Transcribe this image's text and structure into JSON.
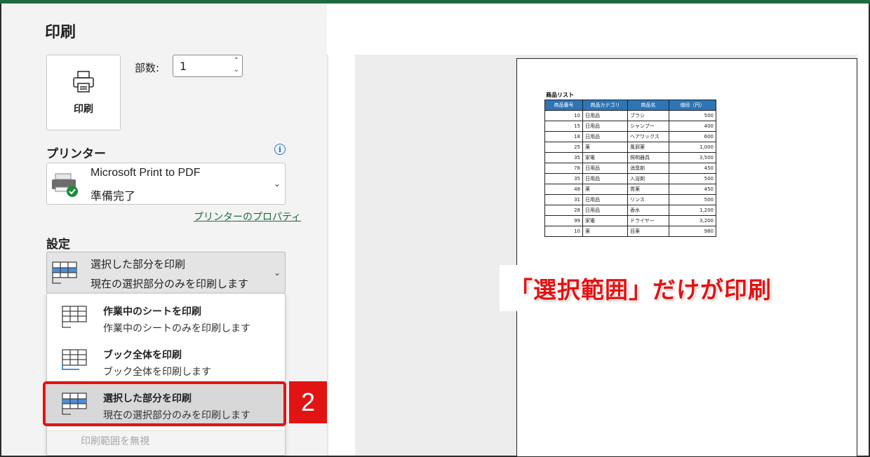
{
  "page": {
    "title": "印刷"
  },
  "print_button": {
    "label": "印刷"
  },
  "copies": {
    "label": "部数:",
    "value": "1"
  },
  "printer": {
    "section_title": "プリンター",
    "name": "Microsoft Print to PDF",
    "status": "準備完了",
    "properties_link": "プリンターのプロパティ"
  },
  "settings": {
    "section_title": "設定",
    "current": {
      "title": "選択した部分を印刷",
      "subtitle": "現在の選択部分のみを印刷します"
    },
    "options": [
      {
        "title": "作業中のシートを印刷",
        "subtitle": "作業中のシートのみを印刷します"
      },
      {
        "title": "ブック全体を印刷",
        "subtitle": "ブック全体を印刷します"
      },
      {
        "title": "選択した部分を印刷",
        "subtitle": "現在の選択部分のみを印刷します"
      }
    ],
    "ignore_print_area": "印刷範囲を無視"
  },
  "annotation": {
    "step": "2",
    "callout": "「選択範囲」だけが印刷"
  },
  "preview": {
    "sheet_title": "商品リスト",
    "columns": [
      "商品番号",
      "商品カテゴリ",
      "商品名",
      "値段（円）"
    ],
    "rows": [
      [
        "10",
        "日用品",
        "ブラシ",
        "500"
      ],
      [
        "15",
        "日用品",
        "シャンプー",
        "400"
      ],
      [
        "18",
        "日用品",
        "ヘアワックス",
        "600"
      ],
      [
        "25",
        "薬",
        "風邪薬",
        "1,000"
      ],
      [
        "35",
        "家電",
        "照明器具",
        "3,500"
      ],
      [
        "78",
        "日用品",
        "消臭剤",
        "450"
      ],
      [
        "35",
        "日用品",
        "入浴剤",
        "500"
      ],
      [
        "48",
        "薬",
        "胃薬",
        "450"
      ],
      [
        "31",
        "日用品",
        "リンス",
        "500"
      ],
      [
        "28",
        "日用品",
        "香水",
        "1,200"
      ],
      [
        "99",
        "家電",
        "ドライヤー",
        "3,200"
      ],
      [
        "10",
        "薬",
        "目薬",
        "980"
      ]
    ]
  },
  "colors": {
    "accent": "#1e6b3f",
    "header_blue": "#2e75b6",
    "highlight_red": "#e21313"
  }
}
